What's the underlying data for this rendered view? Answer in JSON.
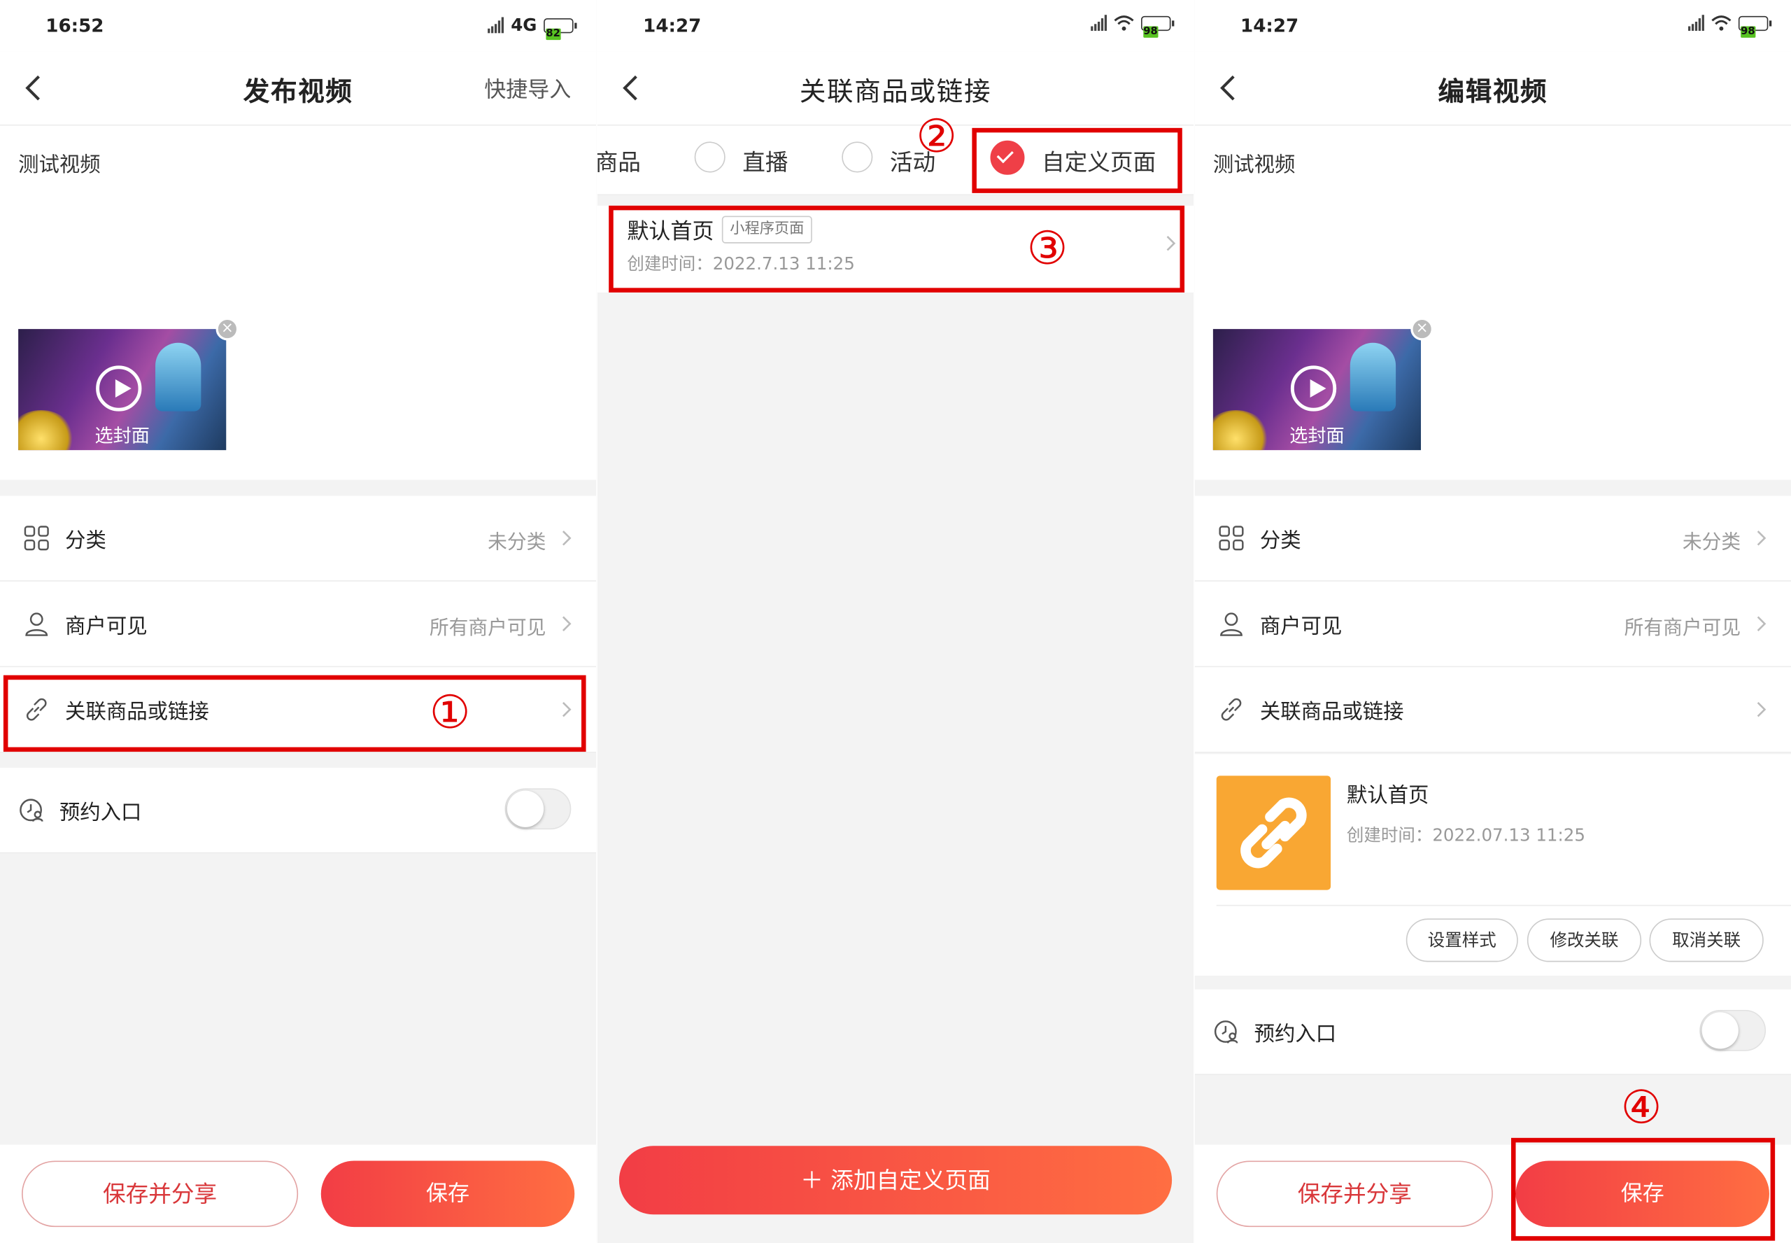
{
  "panel1": {
    "status": {
      "time": "16:52",
      "network": "4G",
      "battery": "82"
    },
    "nav": {
      "title": "发布视频",
      "right": "快捷导入"
    },
    "description": "测试视频",
    "cover_label": "选封面",
    "rows": {
      "category_label": "分类",
      "category_value": "未分类",
      "visibility_label": "商户可见",
      "visibility_value": "所有商户可见",
      "link_label": "关联商品或链接",
      "booking_label": "预约入口"
    },
    "buttons": {
      "save_share": "保存并分享",
      "save": "保存"
    },
    "annotation": "①"
  },
  "panel2": {
    "status": {
      "time": "14:27",
      "battery": "98"
    },
    "nav": {
      "title": "关联商品或链接"
    },
    "tabs": [
      {
        "label": "商品",
        "selected": false
      },
      {
        "label": "直播",
        "selected": false
      },
      {
        "label": "活动",
        "selected": false
      },
      {
        "label": "自定义页面",
        "selected": true
      }
    ],
    "item": {
      "title": "默认首页",
      "tag": "小程序页面",
      "time": "创建时间：2022.7.13 11:25"
    },
    "add_button": "添加自定义页面",
    "annotation2": "②",
    "annotation3": "③"
  },
  "panel3": {
    "status": {
      "time": "14:27",
      "battery": "98"
    },
    "nav": {
      "title": "编辑视频"
    },
    "description": "测试视频",
    "cover_label": "选封面",
    "rows": {
      "category_label": "分类",
      "category_value": "未分类",
      "visibility_label": "商户可见",
      "visibility_value": "所有商户可见",
      "link_label": "关联商品或链接",
      "booking_label": "预约入口"
    },
    "linked": {
      "title": "默认首页",
      "time": "创建时间：2022.07.13 11:25"
    },
    "actions": {
      "style": "设置样式",
      "modify": "修改关联",
      "cancel": "取消关联"
    },
    "buttons": {
      "save_share": "保存并分享",
      "save": "保存"
    },
    "annotation": "④"
  },
  "colors": {
    "accent": "#ef3f47",
    "annotation": "#e10000",
    "link_thumb": "#f9a733"
  }
}
